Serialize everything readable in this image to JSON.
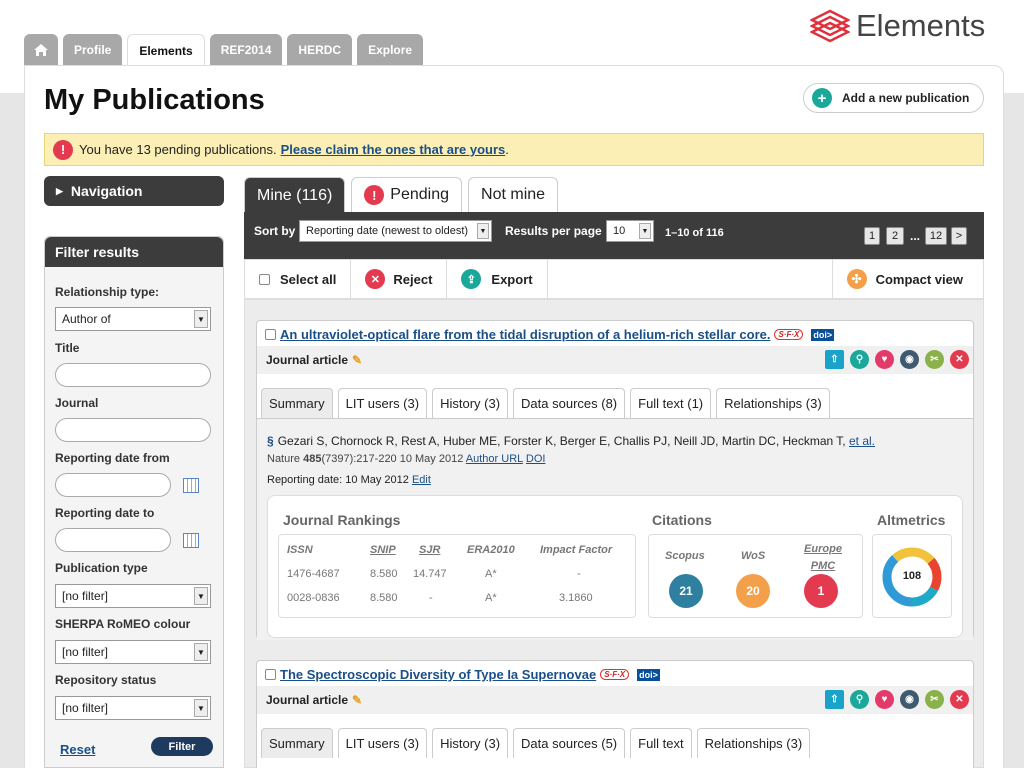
{
  "brand": {
    "name": "Elements"
  },
  "nav_tabs": [
    {
      "label": "Profile"
    },
    {
      "label": "Elements"
    },
    {
      "label": "REF2014"
    },
    {
      "label": "HERDC"
    },
    {
      "label": "Explore"
    }
  ],
  "page": {
    "title": "My Publications",
    "add_button": "Add a new publication"
  },
  "alert": {
    "text": "You have 13 pending publications.",
    "link": "Please claim the ones that are yours",
    "suffix": "."
  },
  "sidebar": {
    "navigation": "Navigation",
    "filter_title": "Filter results",
    "relationship_label": "Relationship type:",
    "relationship_value": "Author of",
    "title_label": "Title",
    "journal_label": "Journal",
    "date_from_label": "Reporting date from",
    "date_to_label": "Reporting date to",
    "pubtype_label": "Publication type",
    "pubtype_value": "[no filter]",
    "sherpa_label": "SHERPA RoMEO colour",
    "sherpa_value": "[no filter]",
    "repo_label": "Repository status",
    "repo_value": "[no filter]",
    "reset": "Reset",
    "filter_button": "Filter"
  },
  "main_tabs": [
    {
      "label": "Mine (116)"
    },
    {
      "label": "Pending"
    },
    {
      "label": "Not mine"
    }
  ],
  "toolbar": {
    "sort_label": "Sort by",
    "sort_value": "Reporting date (newest to oldest)",
    "rpp_label": "Results per page",
    "rpp_value": "10",
    "range": "1–10 of 116",
    "pages": [
      "1",
      "2",
      "...",
      "12",
      ">"
    ]
  },
  "actions": {
    "select_all": "Select all",
    "reject": "Reject",
    "export": "Export",
    "compact": "Compact view"
  },
  "publications": [
    {
      "title": "An ultraviolet-optical flare from the tidal disruption of a helium-rich stellar core.",
      "sfx": "S·F·X",
      "doi": "doi>",
      "type": "Journal article",
      "tabs": [
        "Summary",
        "LIT users (3)",
        "History (3)",
        "Data sources (8)",
        "Full text (1)",
        "Relationships (3)"
      ],
      "authors": "Gezari S, Chornock R, Rest A, Huber ME, Forster K, Berger E, Challis PJ, Neill JD, Martin DC, Heckman T,",
      "etal": "et al.",
      "journal": "Nature",
      "volume": "485",
      "issue_pages": "(7397):217-220 10 May 2012",
      "author_url": "Author URL",
      "doi_link": "DOI",
      "reporting_date": "Reporting date: 10 May 2012",
      "edit": "Edit",
      "rankings_title": "Journal Rankings",
      "rank_headers": [
        "ISSN",
        "SNIP",
        "SJR",
        "ERA2010",
        "Impact Factor"
      ],
      "rank_rows": [
        [
          "1476-4687",
          "8.580",
          "14.747",
          "A*",
          "-"
        ],
        [
          "0028-0836",
          "8.580",
          "-",
          "A*",
          "3.1860"
        ]
      ],
      "citations_title": "Citations",
      "citations": [
        {
          "label": "Scopus",
          "value": "21",
          "color": "#2e7fa0"
        },
        {
          "label": "WoS",
          "value": "20",
          "color": "#f4a04a"
        },
        {
          "label": "Europe PMC",
          "value": "1",
          "color": "#e43a4f"
        }
      ],
      "altmetrics_title": "Altmetrics",
      "altmetric_score": "108"
    },
    {
      "title": "The Spectroscopic Diversity of Type Ia Supernovae",
      "sfx": "S·F·X",
      "doi": "doi>",
      "type": "Journal article",
      "tabs": [
        "Summary",
        "LIT users (3)",
        "History (3)",
        "Data sources (5)",
        "Full text",
        "Relationships (3)"
      ]
    }
  ],
  "colors": {
    "accent_dark": "#3c3c3c",
    "link": "#1a4f8a",
    "alert_bg": "#fbefb6",
    "teal": "#1aa89a",
    "red": "#e43a4f"
  }
}
